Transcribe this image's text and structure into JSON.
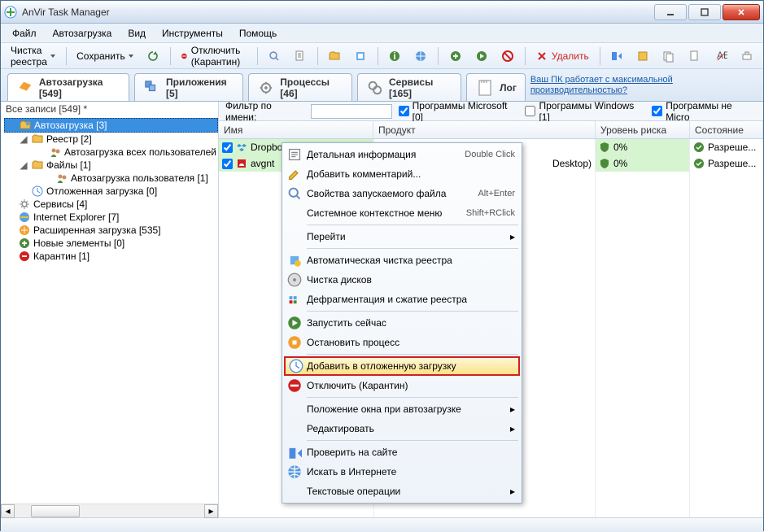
{
  "title": "AnVir Task Manager",
  "menubar": [
    "Файл",
    "Автозагрузка",
    "Вид",
    "Инструменты",
    "Помощь"
  ],
  "toolbar": {
    "cleanup": "Чистка реестра",
    "save": "Сохранить",
    "disable": "Отключить (Карантин)",
    "delete": "Удалить"
  },
  "tabs": [
    {
      "label": "Автозагрузка [549]"
    },
    {
      "label": "Приложения [5]"
    },
    {
      "label": "Процессы [46]"
    },
    {
      "label": "Сервисы [165]"
    },
    {
      "label": "Лог"
    }
  ],
  "promo": "Ваш ПК работает с максимальной производительностью?",
  "sidebar_head": "Все записи [549] *",
  "tree": [
    {
      "lvl": 0,
      "tw": "",
      "sel": true,
      "icon": "folder-star",
      "label": "Автозагрузка [3]"
    },
    {
      "lvl": 1,
      "tw": "◢",
      "icon": "folder",
      "label": "Реестр [2]"
    },
    {
      "lvl": 2,
      "tw": "",
      "icon": "users",
      "label": "Автозагрузка всех пользователей"
    },
    {
      "lvl": 1,
      "tw": "◢",
      "icon": "folder",
      "label": "Файлы [1]"
    },
    {
      "lvl": 2,
      "tw": "",
      "icon": "users",
      "label": "Автозагрузка пользователя [1]"
    },
    {
      "lvl": 1,
      "tw": "",
      "icon": "clock",
      "label": "Отложенная загрузка [0]"
    },
    {
      "lvl": 0,
      "tw": "",
      "icon": "gear",
      "label": "Сервисы [4]"
    },
    {
      "lvl": 0,
      "tw": "",
      "icon": "ie",
      "label": "Internet Explorer [7]"
    },
    {
      "lvl": 0,
      "tw": "",
      "icon": "ext",
      "label": "Расширенная загрузка [535]"
    },
    {
      "lvl": 0,
      "tw": "",
      "icon": "new",
      "label": "Новые элементы [0]"
    },
    {
      "lvl": 0,
      "tw": "",
      "icon": "stop",
      "label": "Карантин [1]"
    }
  ],
  "filter": {
    "label": "Фильтр по имени:",
    "value": "",
    "ms": "Программы Microsoft [0]",
    "win": "Программы Windows [1]",
    "nonms": "Программы не Micro"
  },
  "grid": {
    "cols": [
      "Имя",
      "Продукт",
      "Уровень риска",
      "Состояние"
    ],
    "rows": [
      {
        "chk": true,
        "icon": "dropbox",
        "name": "Dropbo",
        "product": "",
        "risk": "0%",
        "state": "Разреше..."
      },
      {
        "chk": true,
        "icon": "avira",
        "name": "avgnt",
        "product": "Desktop)",
        "risk": "0%",
        "state": "Разреше..."
      }
    ]
  },
  "ctx": [
    {
      "icon": "info",
      "label": "Детальная информация",
      "sc": "Double Click"
    },
    {
      "icon": "edit",
      "label": "Добавить комментарий..."
    },
    {
      "icon": "search",
      "label": "Свойства запускаемого файла",
      "sc": "Alt+Enter"
    },
    {
      "icon": "",
      "label": "Системное контекстное меню",
      "sc": "Shift+RClick"
    },
    {
      "sep": true
    },
    {
      "icon": "",
      "label": "Перейти",
      "sub": true
    },
    {
      "sep": true
    },
    {
      "icon": "clean",
      "label": "Автоматическая чистка реестра"
    },
    {
      "icon": "disk",
      "label": "Чистка дисков"
    },
    {
      "icon": "defrag",
      "label": "Дефрагментация и сжатие реестра"
    },
    {
      "sep": true
    },
    {
      "icon": "run",
      "label": "Запустить сейчас"
    },
    {
      "icon": "stop2",
      "label": "Остановить процесс"
    },
    {
      "sep": true
    },
    {
      "icon": "clock",
      "label": "Добавить в отложенную загрузку",
      "hl": true
    },
    {
      "icon": "no",
      "label": "Отключить (Карантин)"
    },
    {
      "sep": true
    },
    {
      "icon": "",
      "label": "Положение окна при автозагрузке",
      "sub": true
    },
    {
      "icon": "",
      "label": "Редактировать",
      "sub": true
    },
    {
      "sep": true
    },
    {
      "icon": "check",
      "label": "Проверить на сайте"
    },
    {
      "icon": "globe",
      "label": "Искать в Интернете"
    },
    {
      "icon": "",
      "label": "Текстовые операции",
      "sub": true
    }
  ]
}
